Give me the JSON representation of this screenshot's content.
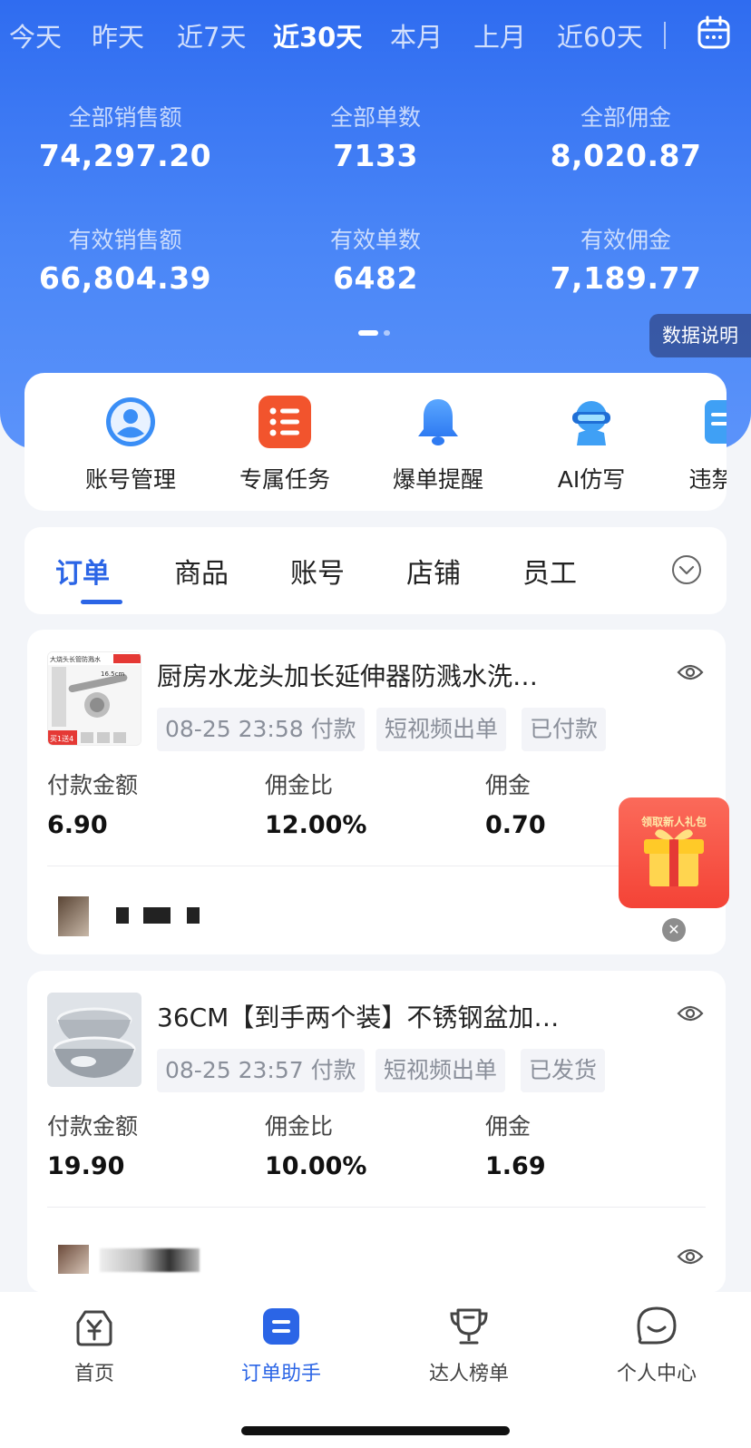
{
  "date_tabs": [
    "今天",
    "昨天",
    "近7天",
    "近30天",
    "本月",
    "上月",
    "近60天"
  ],
  "date_tab_active": "近30天",
  "stats": {
    "total_sales_label": "全部销售额",
    "total_sales": "74,297.20",
    "total_orders_label": "全部单数",
    "total_orders": "7133",
    "total_commission_label": "全部佣金",
    "total_commission": "8,020.87",
    "valid_sales_label": "有效销售额",
    "valid_sales": "66,804.39",
    "valid_orders_label": "有效单数",
    "valid_orders": "6482",
    "valid_commission_label": "有效佣金",
    "valid_commission": "7,189.77"
  },
  "data_note_label": "数据说明",
  "functions": [
    {
      "label": "账号管理",
      "icon": "user-icon"
    },
    {
      "label": "专属任务",
      "icon": "task-list-icon"
    },
    {
      "label": "爆单提醒",
      "icon": "bell-icon"
    },
    {
      "label": "AI仿写",
      "icon": "ai-robot-icon"
    },
    {
      "label": "违禁词",
      "icon": "doc-icon"
    }
  ],
  "tabs": [
    "订单",
    "商品",
    "账号",
    "店铺",
    "员工"
  ],
  "tab_active": "订单",
  "orders": [
    {
      "title": "厨房水龙头加长延伸器防溅水洗…",
      "time": "08-25 23:58 付款",
      "channel": "短视频出单",
      "status": "已付款",
      "pay_label": "付款金额",
      "pay": "6.90",
      "rate_label": "佣金比",
      "rate": "12.00%",
      "commission_label": "佣金",
      "commission": "0.70",
      "thumb_text_1": "大烧头长管防溅水",
      "thumb_text_2": "16.5cm",
      "thumb_text_3": "买1送4"
    },
    {
      "title": "36CM【到手两个装】不锈钢盆加…",
      "time": "08-25 23:57 付款",
      "channel": "短视频出单",
      "status": "已发货",
      "pay_label": "付款金额",
      "pay": "19.90",
      "rate_label": "佣金比",
      "rate": "10.00%",
      "commission_label": "佣金",
      "commission": "1.69"
    }
  ],
  "gift_banner_text": "领取新人礼包",
  "bottom_nav": [
    {
      "label": "首页",
      "icon": "yuan-home-icon"
    },
    {
      "label": "订单助手",
      "icon": "order-assistant-icon"
    },
    {
      "label": "达人榜单",
      "icon": "trophy-icon"
    },
    {
      "label": "个人中心",
      "icon": "chat-face-icon"
    }
  ],
  "bottom_nav_active": "订单助手",
  "colors": {
    "primary": "#2b65e6",
    "hero_top": "#2f6cf0",
    "hero_bottom": "#5b93fa",
    "gift_red": "#f44336"
  }
}
